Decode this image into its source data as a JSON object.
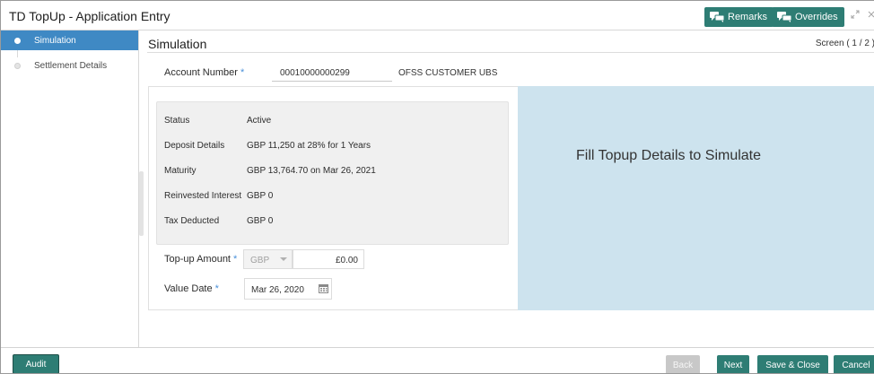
{
  "app": {
    "title": "TD TopUp - Application Entry"
  },
  "header": {
    "remarks_label": "Remarks",
    "overrides_label": "Overrides",
    "accent": "#2e7d74"
  },
  "sidebar": {
    "steps": [
      {
        "label": "Simulation",
        "state": "active"
      },
      {
        "label": "Settlement Details",
        "state": "pending"
      }
    ]
  },
  "main": {
    "title": "Simulation",
    "screen_indicator": "Screen ( 1 / 2 )",
    "account_number": {
      "label": "Account Number",
      "value": "00010000000299",
      "customer_name": "OFSS CUSTOMER UBS"
    },
    "summary": [
      {
        "key": "Status",
        "value": "Active"
      },
      {
        "key": "Deposit Details",
        "value": "GBP 11,250 at 28% for 1 Years"
      },
      {
        "key": "Maturity",
        "value": "GBP 13,764.70 on Mar 26, 2021"
      },
      {
        "key": "Reinvested Interest",
        "value": "GBP 0"
      },
      {
        "key": "Tax Deducted",
        "value": "GBP 0"
      }
    ],
    "topup_amount": {
      "label": "Top-up Amount",
      "currency": "GBP",
      "value": "£0.00"
    },
    "value_date": {
      "label": "Value Date",
      "value": "Mar 26, 2020"
    },
    "simulation_message": "Fill Topup Details to Simulate"
  },
  "footer": {
    "audit_label": "Audit",
    "back_label": "Back",
    "next_label": "Next",
    "save_close_label": "Save & Close",
    "cancel_label": "Cancel"
  }
}
